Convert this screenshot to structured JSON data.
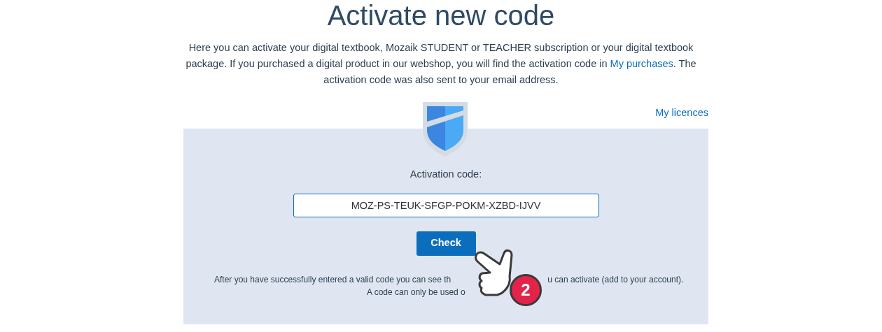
{
  "title": "Activate new code",
  "intro": "Here you can activate your digital textbook, Mozaik STUDENT or TEACHER subscription or your digital textbook package. If you purchased a digital product in our webshop, you will find the activation code in",
  "intro_link": "My purchases",
  "intro_end": ". The activation code was also sent to your email address.",
  "licences_link": "My licences",
  "form": {
    "label": "Activation code:",
    "value": "MOZ-PS-TEUK-SFGP-POKM-XZBD-IJVV",
    "button": "Check"
  },
  "note_lines": [
    {
      "left": "After you have successfully entered a valid code you can see th",
      "right": "u can activate (add to your account)."
    },
    {
      "left": "A code can only be used o"
    }
  ],
  "step_badge": "2"
}
